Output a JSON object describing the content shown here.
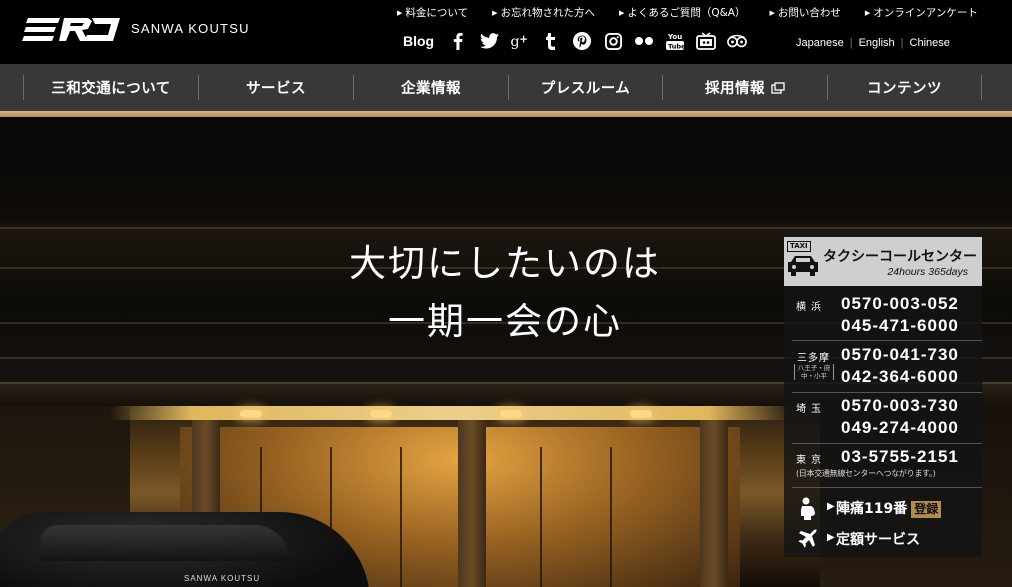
{
  "header": {
    "brand": "SANWA KOUTSU",
    "top_links": [
      "料金について",
      "お忘れ物された方へ",
      "よくあるご質問（Q&A）",
      "お問い合わせ",
      "オンラインアンケート"
    ],
    "blog_label": "Blog",
    "social_icons": [
      "facebook-icon",
      "twitter-icon",
      "google-plus-icon",
      "tumblr-icon",
      "pinterest-icon",
      "instagram-icon",
      "flickr-icon",
      "youtube-icon",
      "tv-icon",
      "tripadvisor-icon"
    ],
    "languages": [
      "Japanese",
      "English",
      "Chinese"
    ]
  },
  "nav": {
    "items": [
      {
        "label": "三和交通について"
      },
      {
        "label": "サービス"
      },
      {
        "label": "企業情報"
      },
      {
        "label": "プレスルーム"
      },
      {
        "label": "採用情報"
      },
      {
        "label": "コンテンツ"
      }
    ]
  },
  "hero": {
    "line1": "大切にしたいのは",
    "line2": "一期一会の心",
    "car_badge": "SANWA KOUTSU"
  },
  "taxi_panel": {
    "tag": "TAXI",
    "title": "タクシーコールセンター",
    "subtitle": "24hours 365days",
    "regions": [
      {
        "name": "横浜",
        "numbers": [
          "0570-003-052",
          "045-471-6000"
        ]
      },
      {
        "name": "三多摩",
        "sub": "八王子・府中・小平",
        "numbers": [
          "0570-041-730",
          "042-364-6000"
        ]
      },
      {
        "name": "埼玉",
        "numbers": [
          "0570-003-730",
          "049-274-4000"
        ]
      },
      {
        "name": "東京",
        "numbers": [
          "03-5755-2151"
        ],
        "note": "(日本交通無線センターへつながります。)"
      }
    ],
    "services": [
      {
        "label": "陣痛119番",
        "badge": "登録"
      },
      {
        "label": "定額サービス"
      }
    ]
  },
  "colors": {
    "nav_bg": "#383838",
    "gold": "#c5a06a",
    "panel_head": "#cfcfcf",
    "badge": "#b38b4d"
  }
}
